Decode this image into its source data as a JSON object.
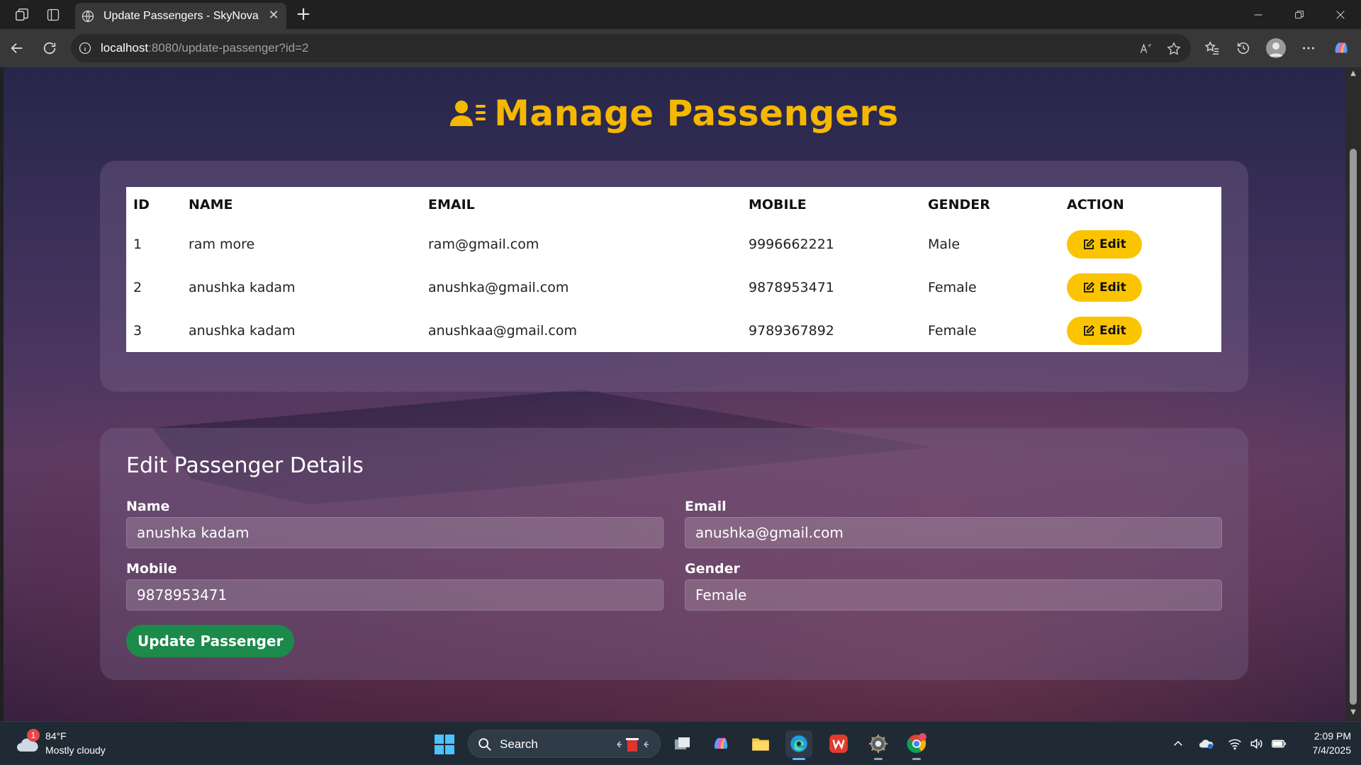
{
  "browser": {
    "tab_title": "Update Passengers - SkyNova",
    "url_host": "localhost",
    "url_rest": ":8080/update-passenger?id=2"
  },
  "page": {
    "title": "Manage Passengers",
    "table": {
      "headers": [
        "ID",
        "NAME",
        "EMAIL",
        "MOBILE",
        "GENDER",
        "ACTION"
      ],
      "rows": [
        {
          "id": "1",
          "name": "ram more",
          "email": "ram@gmail.com",
          "mobile": "9996662221",
          "gender": "Male",
          "action": "Edit"
        },
        {
          "id": "2",
          "name": "anushka kadam",
          "email": "anushka@gmail.com",
          "mobile": "9878953471",
          "gender": "Female",
          "action": "Edit"
        },
        {
          "id": "3",
          "name": "anushka kadam",
          "email": "anushkaa@gmail.com",
          "mobile": "9789367892",
          "gender": "Female",
          "action": "Edit"
        }
      ]
    },
    "form": {
      "title": "Edit Passenger Details",
      "name_label": "Name",
      "name_value": "anushka kadam",
      "email_label": "Email",
      "email_value": "anushka@gmail.com",
      "mobile_label": "Mobile",
      "mobile_value": "9878953471",
      "gender_label": "Gender",
      "gender_value": "Female",
      "submit_label": "Update Passenger"
    }
  },
  "taskbar": {
    "weather_temp": "84°F",
    "weather_desc": "Mostly cloudy",
    "weather_badge": "1",
    "search_label": "Search",
    "time": "2:09 PM",
    "date": "7/4/2025"
  },
  "colors": {
    "accent": "#f5b800",
    "edit_button": "#fbc400",
    "update_button": "#1b8a4a"
  }
}
